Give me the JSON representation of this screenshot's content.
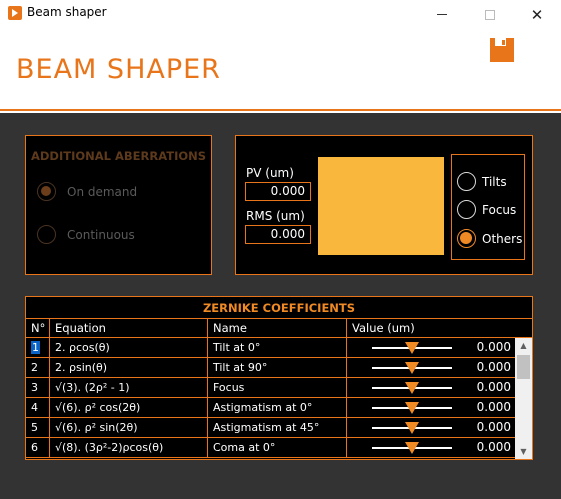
{
  "window": {
    "title": "Beam shaper",
    "icon": "app-play-icon",
    "controls": [
      "minimize-icon",
      "maximize-icon",
      "close-icon"
    ],
    "close_glyph": "✕"
  },
  "header": {
    "title": "BEAM SHAPER",
    "save_icon": "floppy-disk-icon",
    "accent_color": "#e8751a"
  },
  "aberrations": {
    "title": "ADDITIONAL ABERRATIONS",
    "options": [
      {
        "label": "On demand",
        "selected": true
      },
      {
        "label": "Continuous",
        "selected": false
      }
    ]
  },
  "metrics": {
    "pv_label": "PV (um)",
    "pv_value": "0.000",
    "rms_label": "RMS (um)",
    "rms_value": "0.000",
    "preview_color": "#f9b73d",
    "display_options": [
      {
        "label": "Tilts",
        "selected": false
      },
      {
        "label": "Focus",
        "selected": false
      },
      {
        "label": "Others",
        "selected": true
      }
    ]
  },
  "zernike": {
    "title": "ZERNIKE COEFFICIENTS",
    "columns": [
      "N°",
      "Equation",
      "Name",
      "Value (um)"
    ],
    "rows": [
      {
        "n": "1",
        "equation": "2. ρcos(θ)",
        "name": "Tilt at 0°",
        "value": "0.000",
        "slider": 0.5
      },
      {
        "n": "2",
        "equation": "2. ρsin(θ)",
        "name": "Tilt at 90°",
        "value": "0.000",
        "slider": 0.5
      },
      {
        "n": "3",
        "equation": "√(3). (2ρ² - 1)",
        "name": "Focus",
        "value": "0.000",
        "slider": 0.5
      },
      {
        "n": "4",
        "equation": "√(6). ρ² cos(2θ)",
        "name": "Astigmatism at 0°",
        "value": "0.000",
        "slider": 0.5
      },
      {
        "n": "5",
        "equation": "√(6). ρ² sin(2θ)",
        "name": "Astigmatism at 45°",
        "value": "0.000",
        "slider": 0.5
      },
      {
        "n": "6",
        "equation": "√(8). (3ρ²-2)ρcos(θ)",
        "name": "Coma at 0°",
        "value": "0.000",
        "slider": 0.5
      }
    ],
    "scroll_up_glyph": "▲",
    "scroll_down_glyph": "▼"
  }
}
